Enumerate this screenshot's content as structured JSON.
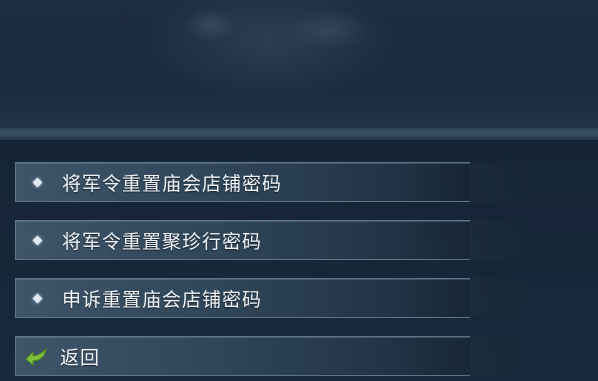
{
  "menu": {
    "items": [
      {
        "label": "将军令重置庙会店铺密码",
        "icon": "diamond-bullet-icon"
      },
      {
        "label": "将军令重置聚珍行密码",
        "icon": "diamond-bullet-icon"
      },
      {
        "label": "申诉重置庙会店铺密码",
        "icon": "diamond-bullet-icon"
      }
    ],
    "back": {
      "label": "返回",
      "icon": "back-arrow-icon"
    }
  },
  "colors": {
    "background": "#172535",
    "item_fill": "#3e5469",
    "item_border": "#5f7488",
    "text": "#f1f4f7",
    "back_arrow": "#7fbf3a"
  }
}
